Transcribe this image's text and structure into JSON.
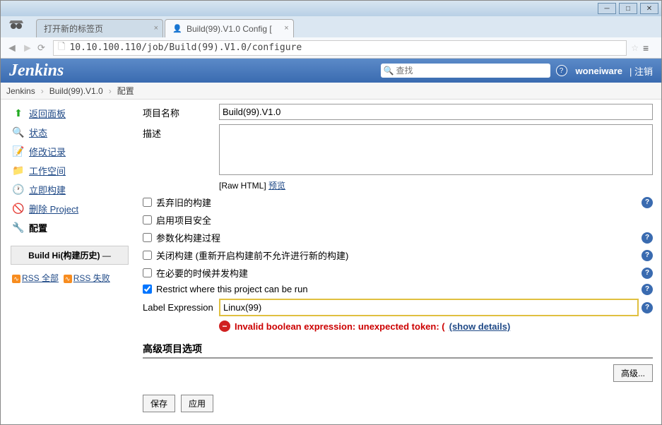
{
  "browser": {
    "tab1": "打开新的标签页",
    "tab2": "Build(99).V1.0 Config [",
    "url": "10.10.100.110/job/Build(99).V1.0/configure"
  },
  "header": {
    "logo": "Jenkins",
    "search_placeholder": "查找",
    "user": "woneiware",
    "logout": "注销"
  },
  "breadcrumb": {
    "a": "Jenkins",
    "b": "Build(99).V1.0",
    "c": "配置"
  },
  "sidebar": {
    "back": "返回面板",
    "status": "状态",
    "changes": "修改记录",
    "workspace": "工作空间",
    "build_now": "立即构建",
    "delete": "删除 Project",
    "configure": "配置",
    "build_history": "Build Hi(构建历史)",
    "rss_all": "RSS 全部",
    "rss_fail": "RSS 失败"
  },
  "form": {
    "name_label": "项目名称",
    "name_value": "Build(99).V1.0",
    "desc_label": "描述",
    "desc_value": "",
    "raw_html": "[Raw HTML]",
    "preview": "预览",
    "discard_old": "丢弃旧的构建",
    "enable_security": "启用项目安全",
    "parameterized": "参数化构建过程",
    "disable_build": "关闭构建 (重新开启构建前不允许进行新的构建)",
    "concurrent": "在必要的时候并发构建",
    "restrict": "Restrict where this project can be run",
    "label_expr_label": "Label Expression",
    "label_expr_value": "Linux(99)",
    "error_text": "Invalid boolean expression: unexpected token: (",
    "show_details": "(show details)",
    "advanced_section": "高级项目选项",
    "advanced_btn": "高级...",
    "save": "保存",
    "apply": "应用"
  }
}
